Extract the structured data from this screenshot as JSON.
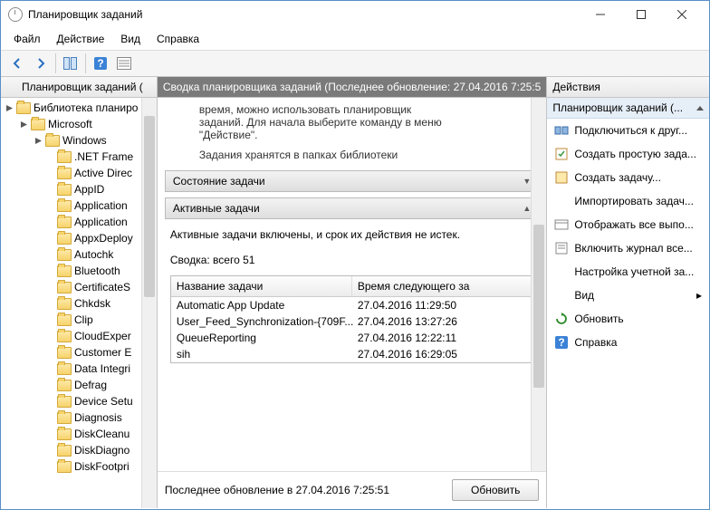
{
  "window": {
    "title": "Планировщик заданий"
  },
  "menu": {
    "file": "Файл",
    "action": "Действие",
    "view": "Вид",
    "help": "Справка"
  },
  "left": {
    "header": "Планировщик заданий (",
    "root": "Библиотека планиро",
    "microsoft": "Microsoft",
    "windows": "Windows",
    "items": [
      ".NET Frame",
      "Active Direc",
      "AppID",
      "Application",
      "Application",
      "AppxDeploy",
      "Autochk",
      "Bluetooth",
      "CertificateS",
      "Chkdsk",
      "Clip",
      "CloudExper",
      "Customer E",
      "Data Integri",
      "Defrag",
      "Device Setu",
      "Diagnosis",
      "DiskCleanu",
      "DiskDiagno",
      "DiskFootpri"
    ]
  },
  "mid": {
    "header": "Сводка планировщика заданий (Последнее обновление: 27.04.2016 7:25:5",
    "intro1": "время, можно использовать планировщик",
    "intro2": "заданий. Для начала выберите команду в меню",
    "intro3": "\"Действие\".",
    "intro4": "Задания хранятся в папках библиотеки",
    "section_status": "Состояние задачи",
    "section_active": "Активные задачи",
    "active_text": "Активные задачи включены, и срок их действия не истек.",
    "summary": "Сводка: всего 51",
    "col1": "Название задачи",
    "col2": "Время следующего за",
    "tasks": [
      {
        "name": "Automatic App Update",
        "time": "27.04.2016 11:29:50"
      },
      {
        "name": "User_Feed_Synchronization-{709F...",
        "time": "27.04.2016 13:27:26"
      },
      {
        "name": "QueueReporting",
        "time": "27.04.2016 12:22:11"
      },
      {
        "name": "sih",
        "time": "27.04.2016 16:29:05"
      }
    ],
    "last_update": "Последнее обновление в 27.04.2016 7:25:51",
    "refresh": "Обновить"
  },
  "right": {
    "header": "Действия",
    "subheader": "Планировщик заданий (...",
    "items": [
      {
        "label": "Подключиться к друг...",
        "icon": "connect"
      },
      {
        "label": "Создать простую зада...",
        "icon": "task-simple"
      },
      {
        "label": "Создать задачу...",
        "icon": "task"
      },
      {
        "label": "Импортировать задач...",
        "icon": "import"
      },
      {
        "label": "Отображать все выпо...",
        "icon": "show"
      },
      {
        "label": "Включить журнал все...",
        "icon": "log"
      },
      {
        "label": "Настройка учетной за...",
        "icon": "account"
      },
      {
        "label": "Вид",
        "icon": "view",
        "sub": true
      },
      {
        "label": "Обновить",
        "icon": "refresh"
      },
      {
        "label": "Справка",
        "icon": "help"
      }
    ]
  }
}
